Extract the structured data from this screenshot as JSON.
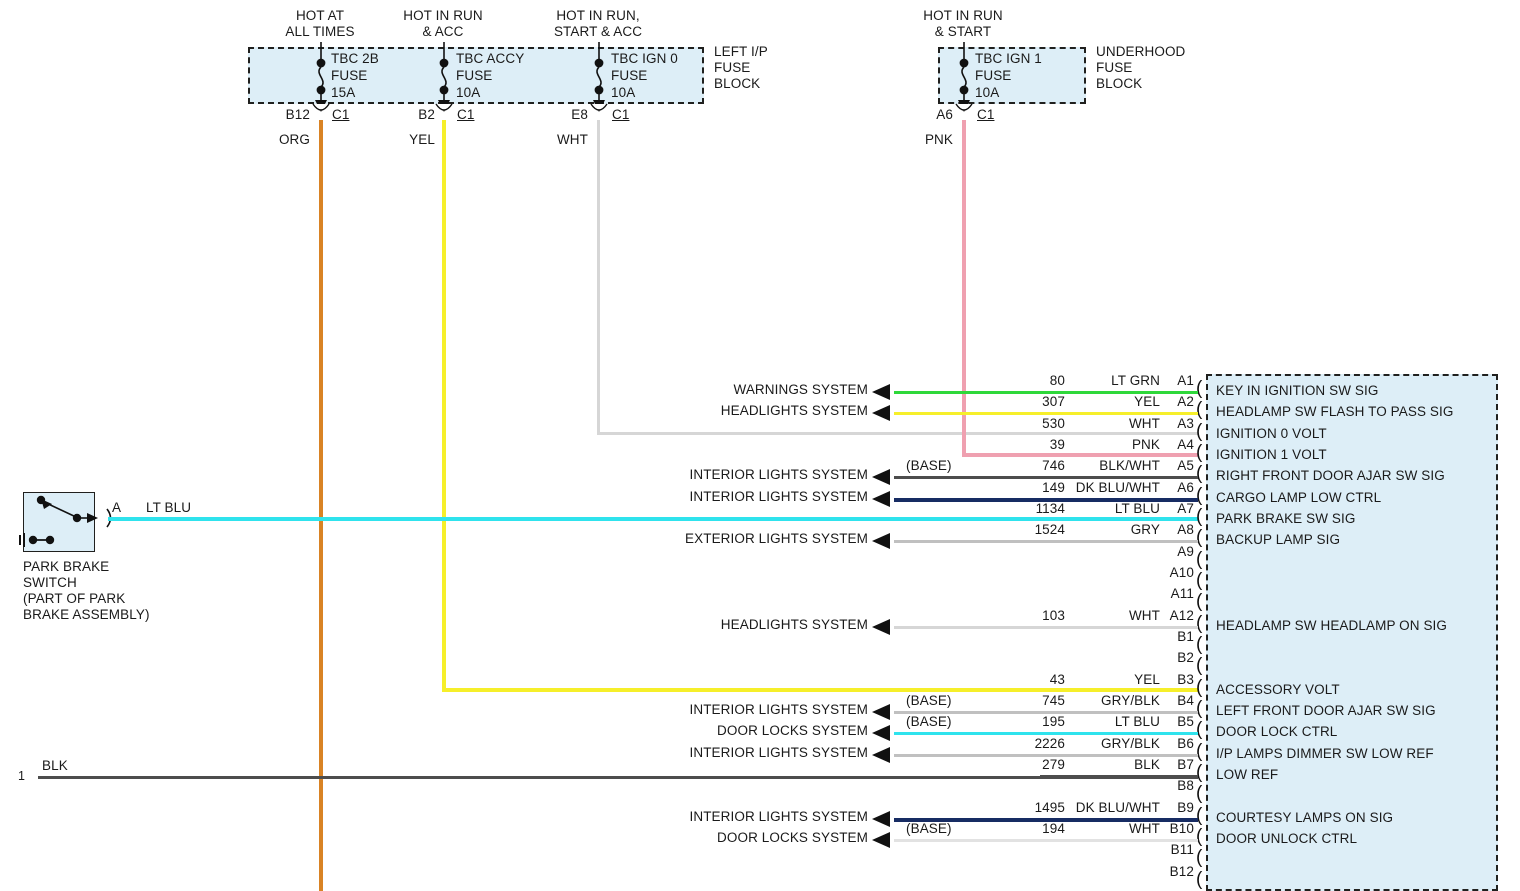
{
  "diagram": {
    "title": "Body Control Module wiring diagram",
    "fuse_blocks": [
      {
        "name": "LEFT I/P FUSE BLOCK",
        "label_lines": [
          "LEFT I/P",
          "FUSE",
          "BLOCK"
        ],
        "fuses": [
          {
            "supply_lines": [
              "HOT AT",
              "ALL TIMES"
            ],
            "name": "TBC 2B",
            "word_fuse": "FUSE",
            "rating": "15A",
            "cavity": "B12",
            "connector": "C1",
            "wire_color_label": "ORG",
            "wire_color": "#d98324"
          },
          {
            "supply_lines": [
              "HOT IN RUN",
              "& ACC"
            ],
            "name": "TBC ACCY",
            "word_fuse": "FUSE",
            "rating": "10A",
            "cavity": "B2",
            "connector": "C1",
            "wire_color_label": "YEL",
            "wire_color": "#f6ef2a"
          },
          {
            "supply_lines": [
              "HOT IN RUN,",
              "START & ACC"
            ],
            "name": "TBC IGN 0",
            "word_fuse": "FUSE",
            "rating": "10A",
            "cavity": "E8",
            "connector": "C1",
            "wire_color_label": "WHT",
            "wire_color": "#d6d6d6"
          }
        ]
      },
      {
        "name": "UNDERHOOD FUSE BLOCK",
        "label_lines": [
          "UNDERHOOD",
          "FUSE",
          "BLOCK"
        ],
        "fuses": [
          {
            "supply_lines": [
              "HOT IN RUN",
              "& START"
            ],
            "name": "TBC IGN 1",
            "word_fuse": "FUSE",
            "rating": "10A",
            "cavity": "A6",
            "connector": "C1",
            "wire_color_label": "PNK",
            "wire_color": "#efa0b0"
          }
        ]
      }
    ],
    "switch": {
      "name_lines": [
        "PARK BRAKE",
        "SWITCH",
        "(PART OF PARK",
        "BRAKE ASSEMBLY)"
      ],
      "terminal": "A",
      "wire_color_label": "LT BLU",
      "wire_color": "#2fe3ed"
    },
    "ground_wire": {
      "pin": "1",
      "wire_color_label": "BLK",
      "wire_color": "#4d4d4d"
    },
    "connector_pins": [
      {
        "pin": "A1",
        "circuit": "80",
        "color_label": "LT GRN",
        "wire_color": "#2ed83a",
        "description": "KEY IN IGNITION SW SIG",
        "system": "WARNINGS SYSTEM",
        "base": "",
        "arrow": true,
        "wired": true
      },
      {
        "pin": "A2",
        "circuit": "307",
        "color_label": "YEL",
        "wire_color": "#f6ef2a",
        "description": "HEADLAMP SW FLASH TO PASS SIG",
        "system": "HEADLIGHTS SYSTEM",
        "base": "",
        "arrow": true,
        "wired": true
      },
      {
        "pin": "A3",
        "circuit": "530",
        "color_label": "WHT",
        "wire_color": "#d6d6d6",
        "description": "IGNITION 0 VOLT",
        "system": "",
        "base": "",
        "arrow": false,
        "wired": true
      },
      {
        "pin": "A4",
        "circuit": "39",
        "color_label": "PNK",
        "wire_color": "#efa0b0",
        "description": "IGNITION 1 VOLT",
        "system": "",
        "base": "",
        "arrow": false,
        "wired": true
      },
      {
        "pin": "A5",
        "circuit": "746",
        "color_label": "BLK/WHT",
        "wire_color": "#4d4d4d",
        "description": "RIGHT FRONT DOOR AJAR SW SIG",
        "system": "INTERIOR LIGHTS SYSTEM",
        "base": "(BASE)",
        "arrow": true,
        "wired": true
      },
      {
        "pin": "A6",
        "circuit": "149",
        "color_label": "DK BLU/WHT",
        "wire_color": "#172c63",
        "description": "CARGO LAMP LOW CTRL",
        "system": "INTERIOR LIGHTS SYSTEM",
        "base": "",
        "arrow": true,
        "wired": true
      },
      {
        "pin": "A7",
        "circuit": "1134",
        "color_label": "LT BLU",
        "wire_color": "#2fe3ed",
        "description": "PARK BRAKE SW SIG",
        "system": "",
        "base": "",
        "arrow": false,
        "wired": true
      },
      {
        "pin": "A8",
        "circuit": "1524",
        "color_label": "GRY",
        "wire_color": "#c0c0c0",
        "description": "BACKUP LAMP SIG",
        "system": "EXTERIOR LIGHTS SYSTEM",
        "base": "",
        "arrow": true,
        "wired": true
      },
      {
        "pin": "A9",
        "circuit": "",
        "color_label": "",
        "wire_color": "",
        "description": "",
        "system": "",
        "base": "",
        "arrow": false,
        "wired": false
      },
      {
        "pin": "A10",
        "circuit": "",
        "color_label": "",
        "wire_color": "",
        "description": "",
        "system": "",
        "base": "",
        "arrow": false,
        "wired": false
      },
      {
        "pin": "A11",
        "circuit": "",
        "color_label": "",
        "wire_color": "",
        "description": "",
        "system": "",
        "base": "",
        "arrow": false,
        "wired": false
      },
      {
        "pin": "A12",
        "circuit": "103",
        "color_label": "WHT",
        "wire_color": "#d6d6d6",
        "description": "HEADLAMP SW HEADLAMP ON SIG",
        "system": "HEADLIGHTS SYSTEM",
        "base": "",
        "arrow": true,
        "wired": true
      },
      {
        "pin": "B1",
        "circuit": "",
        "color_label": "",
        "wire_color": "",
        "description": "",
        "system": "",
        "base": "",
        "arrow": false,
        "wired": false
      },
      {
        "pin": "B2",
        "circuit": "",
        "color_label": "",
        "wire_color": "",
        "description": "",
        "system": "",
        "base": "",
        "arrow": false,
        "wired": false
      },
      {
        "pin": "B3",
        "circuit": "43",
        "color_label": "YEL",
        "wire_color": "#f6ef2a",
        "description": "ACCESSORY VOLT",
        "system": "",
        "base": "",
        "arrow": false,
        "wired": true
      },
      {
        "pin": "B4",
        "circuit": "745",
        "color_label": "GRY/BLK",
        "wire_color": "#c0c0c0",
        "description": "LEFT FRONT DOOR AJAR SW SIG",
        "system": "INTERIOR LIGHTS SYSTEM",
        "base": "(BASE)",
        "arrow": true,
        "wired": true
      },
      {
        "pin": "B5",
        "circuit": "195",
        "color_label": "LT BLU",
        "wire_color": "#2fe3ed",
        "description": "DOOR LOCK CTRL",
        "system": "DOOR LOCKS SYSTEM",
        "base": "(BASE)",
        "arrow": true,
        "wired": true
      },
      {
        "pin": "B6",
        "circuit": "2226",
        "color_label": "GRY/BLK",
        "wire_color": "#c0c0c0",
        "description": "I/P LAMPS DIMMER SW LOW REF",
        "system": "INTERIOR LIGHTS SYSTEM",
        "base": "",
        "arrow": true,
        "wired": true
      },
      {
        "pin": "B7",
        "circuit": "279",
        "color_label": "BLK",
        "wire_color": "#4d4d4d",
        "description": "LOW REF",
        "system": "",
        "base": "",
        "arrow": false,
        "wired": true
      },
      {
        "pin": "B8",
        "circuit": "",
        "color_label": "",
        "wire_color": "",
        "description": "",
        "system": "",
        "base": "",
        "arrow": false,
        "wired": false
      },
      {
        "pin": "B9",
        "circuit": "1495",
        "color_label": "DK BLU/WHT",
        "wire_color": "#172c63",
        "description": "COURTESY LAMPS ON SIG",
        "system": "INTERIOR LIGHTS SYSTEM",
        "base": "",
        "arrow": true,
        "wired": true
      },
      {
        "pin": "B10",
        "circuit": "194",
        "color_label": "WHT",
        "wire_color": "#e2e2e2",
        "description": "DOOR UNLOCK CTRL",
        "system": "DOOR LOCKS SYSTEM",
        "base": "(BASE)",
        "arrow": true,
        "wired": true
      },
      {
        "pin": "B11",
        "circuit": "",
        "color_label": "",
        "wire_color": "",
        "description": "",
        "system": "",
        "base": "",
        "arrow": false,
        "wired": false
      },
      {
        "pin": "B12",
        "circuit": "",
        "color_label": "",
        "wire_color": "",
        "description": "",
        "system": "",
        "base": "",
        "arrow": false,
        "wired": false
      }
    ]
  }
}
